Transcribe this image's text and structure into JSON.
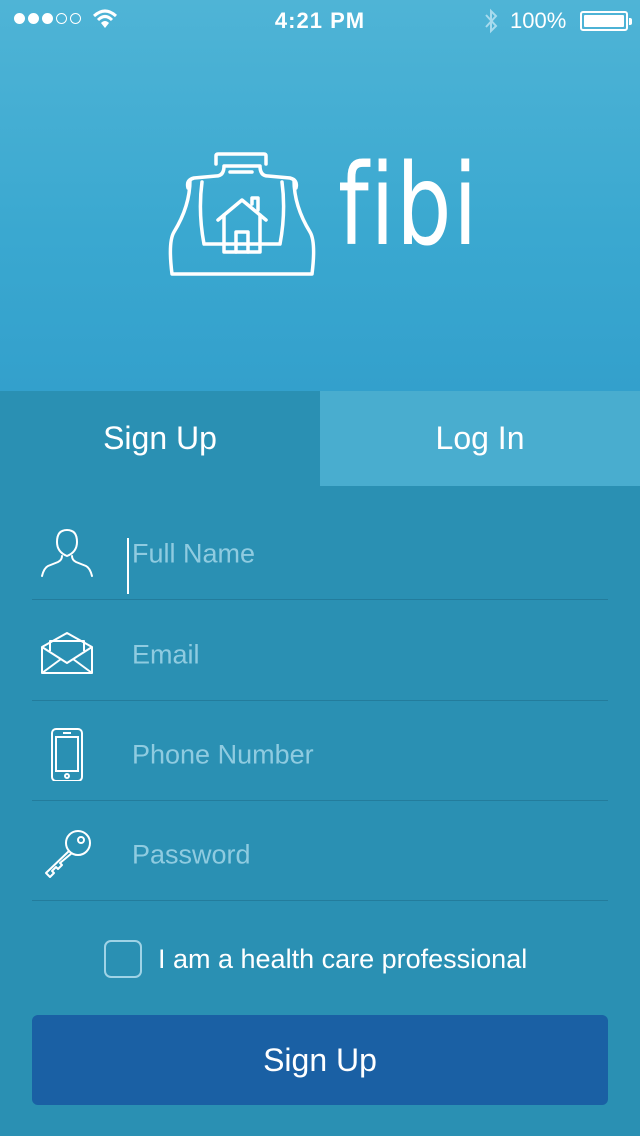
{
  "status_bar": {
    "time": "4:21 PM",
    "battery": "100%"
  },
  "logo": {
    "text": "fibi"
  },
  "tabs": [
    {
      "label": "Sign Up",
      "active": true
    },
    {
      "label": "Log In",
      "active": false
    }
  ],
  "form": {
    "fields": [
      {
        "placeholder": "Full Name",
        "icon": "person-icon"
      },
      {
        "placeholder": "Email",
        "icon": "envelope-icon"
      },
      {
        "placeholder": "Phone Number",
        "icon": "phone-icon"
      },
      {
        "placeholder": "Password",
        "icon": "key-icon"
      }
    ],
    "checkbox_label": "I am a health care professional",
    "submit_label": "Sign Up"
  },
  "colors": {
    "hero": "#3aa8d0",
    "form_bg": "#2a90b3",
    "inactive_tab": "#49adcf",
    "button": "#1a60a4"
  }
}
